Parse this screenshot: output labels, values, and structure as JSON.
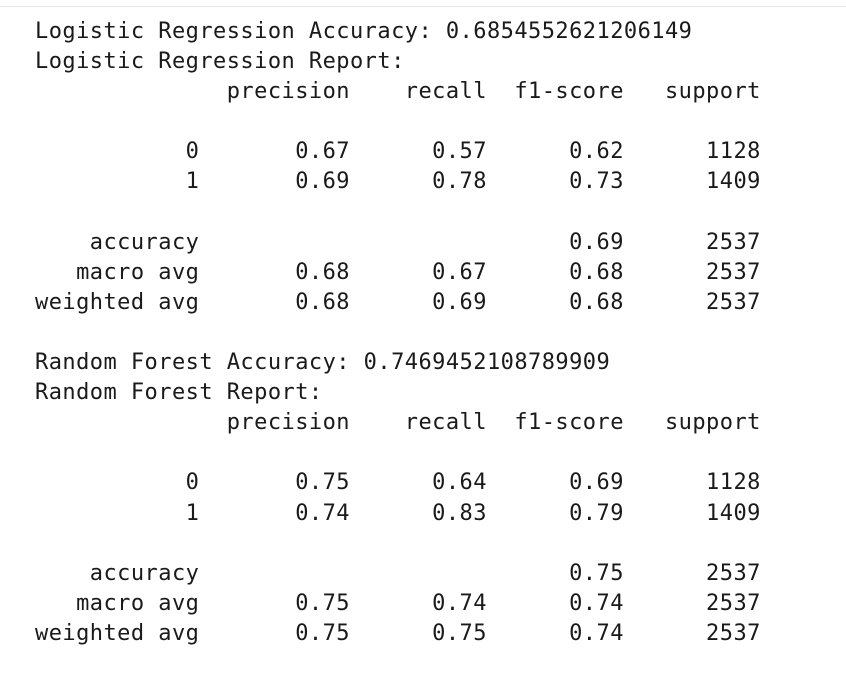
{
  "output": {
    "lines": [
      "Logistic Regression Accuracy: 0.6854552621206149",
      "Logistic Regression Report:",
      "              precision    recall  f1-score   support",
      "",
      "           0       0.67      0.57      0.62      1128",
      "           1       0.69      0.78      0.73      1409",
      "",
      "    accuracy                           0.69      2537",
      "   macro avg       0.68      0.67      0.68      2537",
      "weighted avg       0.68      0.69      0.68      2537",
      "",
      "Random Forest Accuracy: 0.7469452108789909",
      "Random Forest Report:",
      "              precision    recall  f1-score   support",
      "",
      "           0       0.75      0.64      0.69      1128",
      "           1       0.74      0.83      0.79      1409",
      "",
      "    accuracy                           0.75      2537",
      "   macro avg       0.75      0.74      0.74      2537",
      "weighted avg       0.75      0.75      0.74      2537"
    ]
  }
}
